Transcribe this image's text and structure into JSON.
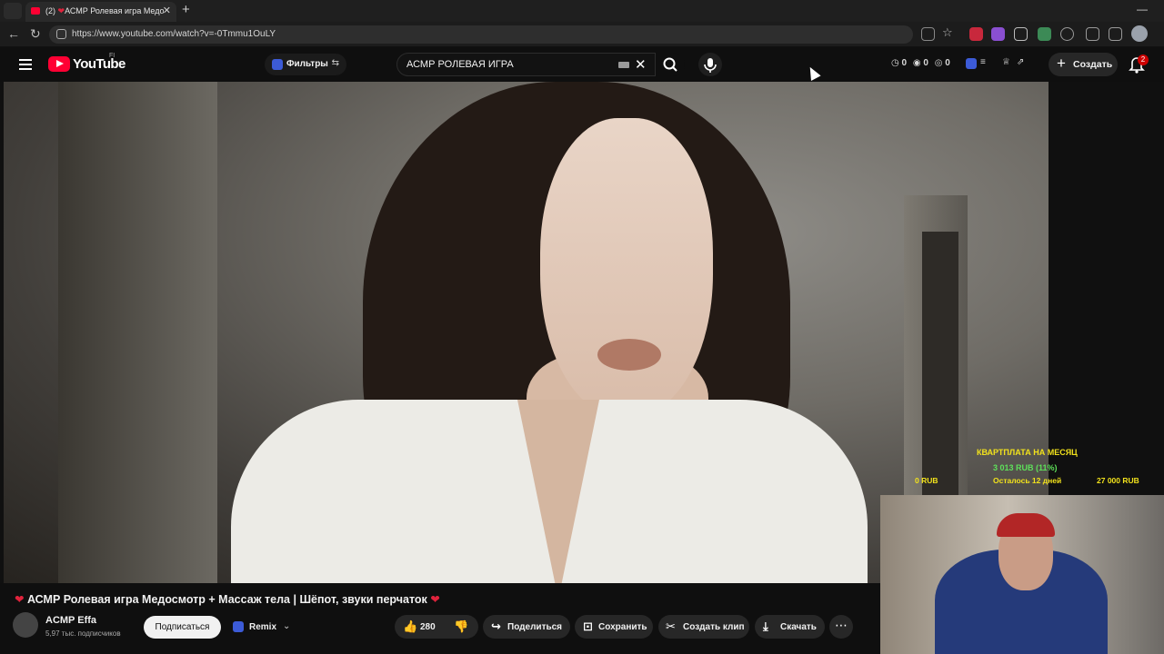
{
  "browser": {
    "tab_count": "(2)",
    "tab_title": "АСМР Ролевая игра Медо",
    "url": "https://www.youtube.com/watch?v=-0Tmmu1OuLY"
  },
  "header": {
    "logo_text": "YouTube",
    "logo_country": "FI",
    "filters_label": "Фильтры",
    "search_query": "АСМР РОЛЕВАЯ ИГРА",
    "stats": [
      "0",
      "0",
      "0"
    ],
    "create_label": "Создать",
    "notif_count": "2"
  },
  "overlay": {
    "rent_title": "КВАРТПЛАТА НА МЕСЯЦ",
    "rent_amount": "3 013 RUB (11%)",
    "rent_min": "0 RUB",
    "rent_left": "Осталось 12 дней",
    "rent_max": "27 000 RUB"
  },
  "video": {
    "title": "АСМР Ролевая игра Медосмотр + Массаж тела | Шёпот, звуки перчаток",
    "channel": "ACMP Effa",
    "subscribers": "5,97 тыс. подписчиков",
    "subscribe_label": "Подписаться",
    "remix_label": "Remix",
    "likes": "280",
    "share_label": "Поделиться",
    "save_label": "Сохранить",
    "clip_label": "Создать клип",
    "download_label": "Скачать"
  },
  "colors": {
    "accent": "#ff0033",
    "overlay_yellow": "#f2e21c",
    "overlay_green": "#5ee05a"
  }
}
